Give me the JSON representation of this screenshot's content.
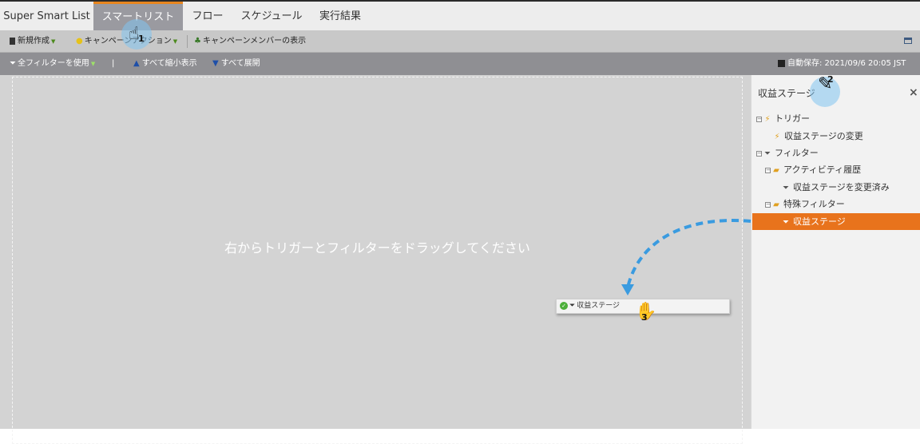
{
  "tabs": [
    {
      "label": "Super Smart List",
      "active": false
    },
    {
      "label": "スマートリスト",
      "active": true
    },
    {
      "label": "フロー",
      "active": false
    },
    {
      "label": "スケジュール",
      "active": false
    },
    {
      "label": "実行結果",
      "active": false
    }
  ],
  "toolbar": {
    "new_label": "新規作成",
    "campaign_action_label": "キャンペーンアクション",
    "campaign_members_label": "キャンペーンメンバーの表示",
    "use_all_filters_label": "全フィルターを使用",
    "separator_text": "|",
    "collapse_all_label": "すべて縮小表示",
    "expand_all_label": "すべて展開",
    "autosave_label": "自動保存: 2021/09/6 20:05 JST"
  },
  "canvas": {
    "placeholder": "右からトリガーとフィルターをドラッグしてください",
    "drag_chip_label": "収益ステージ"
  },
  "panel": {
    "title": "収益ステージ",
    "close_symbol": "×",
    "tree": [
      {
        "label": "トリガー",
        "level": 0,
        "icon": "trigger-icon",
        "toggle": true
      },
      {
        "label": "収益ステージの変更",
        "level": 1,
        "icon": "trigger-icon",
        "toggle": false
      },
      {
        "label": "フィルター",
        "level": 0,
        "icon": "filter-icon",
        "toggle": true
      },
      {
        "label": "アクティビティ履歴",
        "level": 1,
        "icon": "folder-icon",
        "toggle": true
      },
      {
        "label": "収益ステージを変更済み",
        "level": 2,
        "icon": "filter-icon",
        "toggle": false
      },
      {
        "label": "特殊フィルター",
        "level": 1,
        "icon": "folder-icon",
        "toggle": true
      },
      {
        "label": "収益ステージ",
        "level": 2,
        "icon": "filter-icon",
        "toggle": false,
        "selected": true
      }
    ]
  },
  "annotations": [
    "1",
    "2",
    "3"
  ],
  "colors": {
    "accent_orange": "#e8731c",
    "tab_active": "#9a9aa0",
    "callout_blue": "#3a9be0"
  }
}
